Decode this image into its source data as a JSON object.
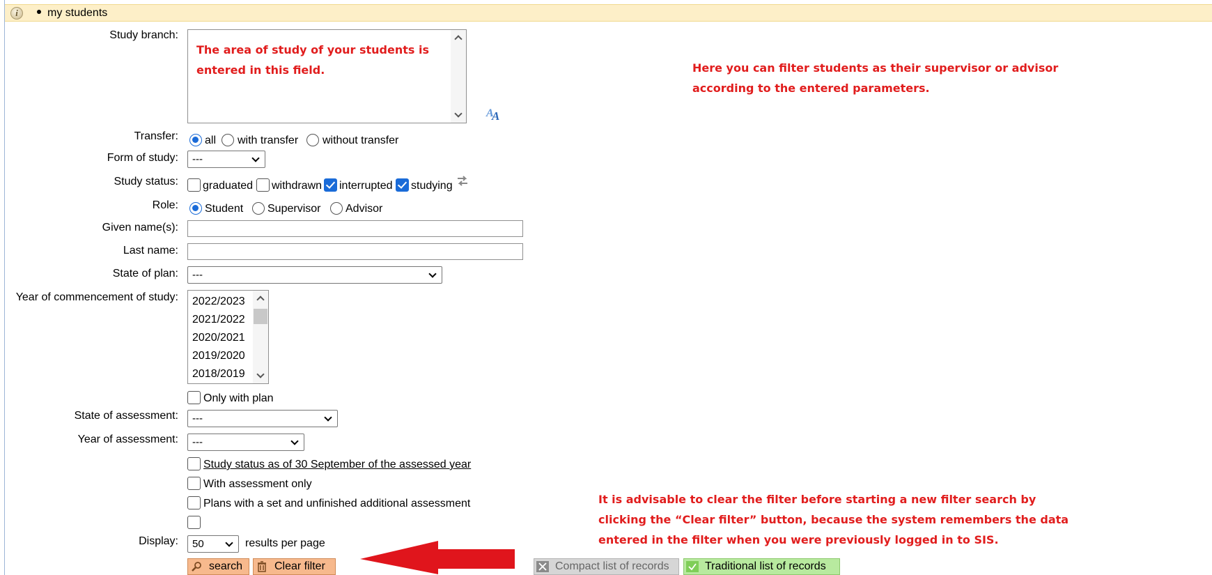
{
  "header": {
    "breadcrumb": "my students"
  },
  "form": {
    "study_branch_label": "Study branch:",
    "study_branch_note": "The area of study of your students is\nentered in this field.",
    "transfer_label": "Transfer:",
    "transfer_options": [
      "all",
      "with transfer",
      "without transfer"
    ],
    "transfer_selected": "all",
    "form_of_study_label": "Form of study:",
    "form_of_study_value": "---",
    "study_status_label": "Study status:",
    "study_status_options": [
      {
        "label": "graduated",
        "checked": false
      },
      {
        "label": "withdrawn",
        "checked": false
      },
      {
        "label": "interrupted",
        "checked": true
      },
      {
        "label": "studying",
        "checked": true
      }
    ],
    "role_label": "Role:",
    "role_options": [
      "Student",
      "Supervisor",
      "Advisor"
    ],
    "role_selected": "Student",
    "given_names_label": "Given name(s):",
    "last_name_label": "Last name:",
    "state_of_plan_label": "State of plan:",
    "state_of_plan_value": "---",
    "year_commencement_label": "Year of commencement of study:",
    "year_options": [
      "2022/2023",
      "2021/2022",
      "2020/2021",
      "2019/2020",
      "2018/2019"
    ],
    "only_with_plan_label": "Only with plan",
    "state_of_assessment_label": "State of assessment:",
    "state_of_assessment_value": "---",
    "year_of_assessment_label": "Year of assessment:",
    "year_of_assessment_value": "---",
    "status_as_of_label": "Study status as of 30 September of the assessed year",
    "with_assessment_only_label": "With assessment only",
    "plans_unfinished_label": "Plans with a set and unfinished additional assessment",
    "display_label": "Display:",
    "display_value": "50",
    "results_per_page": "results per page"
  },
  "buttons": {
    "search": "search",
    "clear_filter": "Clear filter",
    "compact_list": "Compact list of records",
    "traditional_list": "Traditional list of records"
  },
  "notes": {
    "top_right": "Here you can filter students as their supervisor or advisor\naccording to the entered parameters.",
    "bottom_right": "It is advisable to clear the filter before starting a new filter search by\nclicking the “Clear filter” button, because the system remembers the data\nentered in the filter when you were previously logged in to SIS."
  },
  "colors": {
    "header_bg": "#fdefc8",
    "note_red": "#e11d1d",
    "arrow_red": "#e0151c",
    "button_orange": "#f7b98d",
    "button_green": "#b8ea9f",
    "button_gray": "#d6d6d6",
    "accent_blue": "#1a6bd8"
  }
}
